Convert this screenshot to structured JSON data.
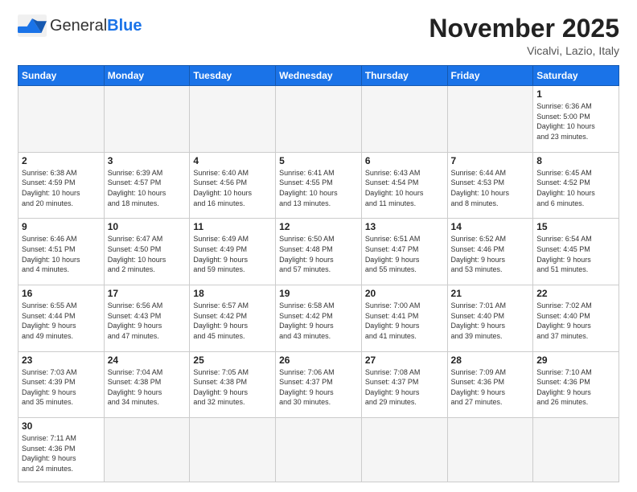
{
  "header": {
    "logo_general": "General",
    "logo_blue": "Blue",
    "month_title": "November 2025",
    "location": "Vicalvi, Lazio, Italy"
  },
  "weekdays": [
    "Sunday",
    "Monday",
    "Tuesday",
    "Wednesday",
    "Thursday",
    "Friday",
    "Saturday"
  ],
  "days": [
    {
      "num": "",
      "info": "",
      "empty": true
    },
    {
      "num": "",
      "info": "",
      "empty": true
    },
    {
      "num": "",
      "info": "",
      "empty": true
    },
    {
      "num": "",
      "info": "",
      "empty": true
    },
    {
      "num": "",
      "info": "",
      "empty": true
    },
    {
      "num": "",
      "info": "",
      "empty": true
    },
    {
      "num": "1",
      "info": "Sunrise: 6:36 AM\nSunset: 5:00 PM\nDaylight: 10 hours\nand 23 minutes."
    }
  ],
  "rows": [
    [
      {
        "num": "2",
        "info": "Sunrise: 6:38 AM\nSunset: 4:59 PM\nDaylight: 10 hours\nand 20 minutes."
      },
      {
        "num": "3",
        "info": "Sunrise: 6:39 AM\nSunset: 4:57 PM\nDaylight: 10 hours\nand 18 minutes."
      },
      {
        "num": "4",
        "info": "Sunrise: 6:40 AM\nSunset: 4:56 PM\nDaylight: 10 hours\nand 16 minutes."
      },
      {
        "num": "5",
        "info": "Sunrise: 6:41 AM\nSunset: 4:55 PM\nDaylight: 10 hours\nand 13 minutes."
      },
      {
        "num": "6",
        "info": "Sunrise: 6:43 AM\nSunset: 4:54 PM\nDaylight: 10 hours\nand 11 minutes."
      },
      {
        "num": "7",
        "info": "Sunrise: 6:44 AM\nSunset: 4:53 PM\nDaylight: 10 hours\nand 8 minutes."
      },
      {
        "num": "8",
        "info": "Sunrise: 6:45 AM\nSunset: 4:52 PM\nDaylight: 10 hours\nand 6 minutes."
      }
    ],
    [
      {
        "num": "9",
        "info": "Sunrise: 6:46 AM\nSunset: 4:51 PM\nDaylight: 10 hours\nand 4 minutes."
      },
      {
        "num": "10",
        "info": "Sunrise: 6:47 AM\nSunset: 4:50 PM\nDaylight: 10 hours\nand 2 minutes."
      },
      {
        "num": "11",
        "info": "Sunrise: 6:49 AM\nSunset: 4:49 PM\nDaylight: 9 hours\nand 59 minutes."
      },
      {
        "num": "12",
        "info": "Sunrise: 6:50 AM\nSunset: 4:48 PM\nDaylight: 9 hours\nand 57 minutes."
      },
      {
        "num": "13",
        "info": "Sunrise: 6:51 AM\nSunset: 4:47 PM\nDaylight: 9 hours\nand 55 minutes."
      },
      {
        "num": "14",
        "info": "Sunrise: 6:52 AM\nSunset: 4:46 PM\nDaylight: 9 hours\nand 53 minutes."
      },
      {
        "num": "15",
        "info": "Sunrise: 6:54 AM\nSunset: 4:45 PM\nDaylight: 9 hours\nand 51 minutes."
      }
    ],
    [
      {
        "num": "16",
        "info": "Sunrise: 6:55 AM\nSunset: 4:44 PM\nDaylight: 9 hours\nand 49 minutes."
      },
      {
        "num": "17",
        "info": "Sunrise: 6:56 AM\nSunset: 4:43 PM\nDaylight: 9 hours\nand 47 minutes."
      },
      {
        "num": "18",
        "info": "Sunrise: 6:57 AM\nSunset: 4:42 PM\nDaylight: 9 hours\nand 45 minutes."
      },
      {
        "num": "19",
        "info": "Sunrise: 6:58 AM\nSunset: 4:42 PM\nDaylight: 9 hours\nand 43 minutes."
      },
      {
        "num": "20",
        "info": "Sunrise: 7:00 AM\nSunset: 4:41 PM\nDaylight: 9 hours\nand 41 minutes."
      },
      {
        "num": "21",
        "info": "Sunrise: 7:01 AM\nSunset: 4:40 PM\nDaylight: 9 hours\nand 39 minutes."
      },
      {
        "num": "22",
        "info": "Sunrise: 7:02 AM\nSunset: 4:40 PM\nDaylight: 9 hours\nand 37 minutes."
      }
    ],
    [
      {
        "num": "23",
        "info": "Sunrise: 7:03 AM\nSunset: 4:39 PM\nDaylight: 9 hours\nand 35 minutes."
      },
      {
        "num": "24",
        "info": "Sunrise: 7:04 AM\nSunset: 4:38 PM\nDaylight: 9 hours\nand 34 minutes."
      },
      {
        "num": "25",
        "info": "Sunrise: 7:05 AM\nSunset: 4:38 PM\nDaylight: 9 hours\nand 32 minutes."
      },
      {
        "num": "26",
        "info": "Sunrise: 7:06 AM\nSunset: 4:37 PM\nDaylight: 9 hours\nand 30 minutes."
      },
      {
        "num": "27",
        "info": "Sunrise: 7:08 AM\nSunset: 4:37 PM\nDaylight: 9 hours\nand 29 minutes."
      },
      {
        "num": "28",
        "info": "Sunrise: 7:09 AM\nSunset: 4:36 PM\nDaylight: 9 hours\nand 27 minutes."
      },
      {
        "num": "29",
        "info": "Sunrise: 7:10 AM\nSunset: 4:36 PM\nDaylight: 9 hours\nand 26 minutes."
      }
    ],
    [
      {
        "num": "30",
        "info": "Sunrise: 7:11 AM\nSunset: 4:36 PM\nDaylight: 9 hours\nand 24 minutes.",
        "last": true
      },
      {
        "num": "",
        "info": "",
        "empty": true,
        "last": true
      },
      {
        "num": "",
        "info": "",
        "empty": true,
        "last": true
      },
      {
        "num": "",
        "info": "",
        "empty": true,
        "last": true
      },
      {
        "num": "",
        "info": "",
        "empty": true,
        "last": true
      },
      {
        "num": "",
        "info": "",
        "empty": true,
        "last": true
      },
      {
        "num": "",
        "info": "",
        "empty": true,
        "last": true
      }
    ]
  ]
}
